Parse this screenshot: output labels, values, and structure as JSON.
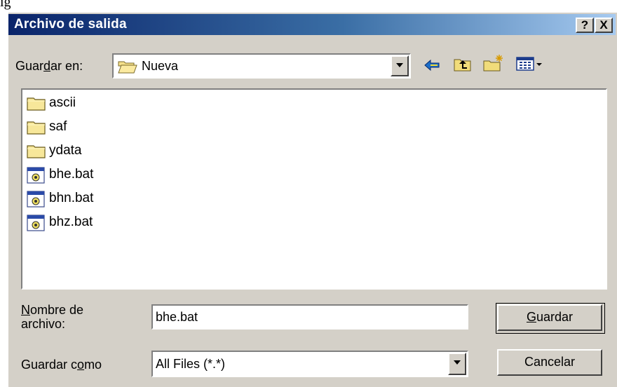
{
  "window": {
    "title": "Archivo de salida",
    "help_button": "?",
    "close_button": "X"
  },
  "save_in": {
    "label_pre": "Guar",
    "label_key": "d",
    "label_post": "ar en:",
    "location": "Nueva",
    "location_icon": "folder-open-icon"
  },
  "toolbar": {
    "back_icon": "back-arrow-icon",
    "up_icon": "up-one-level-icon",
    "new_folder_icon": "new-folder-icon",
    "view_menu_icon": "view-menu-icon"
  },
  "files": [
    {
      "name": "ascii",
      "type": "folder",
      "icon": "folder-icon"
    },
    {
      "name": "saf",
      "type": "folder",
      "icon": "folder-icon"
    },
    {
      "name": "ydata",
      "type": "folder",
      "icon": "folder-icon"
    },
    {
      "name": "bhe.bat",
      "type": "batch",
      "icon": "batch-file-icon"
    },
    {
      "name": "bhn.bat",
      "type": "batch",
      "icon": "batch-file-icon"
    },
    {
      "name": "bhz.bat",
      "type": "batch",
      "icon": "batch-file-icon"
    }
  ],
  "filename": {
    "label_line1_key": "N",
    "label_line1_rest": "ombre de",
    "label_line2": "archivo:",
    "value": "bhe.bat"
  },
  "save_as": {
    "label_pre": "Guardar c",
    "label_key": "o",
    "label_post": "mo",
    "value": "All Files (*.*)"
  },
  "buttons": {
    "save_key": "G",
    "save_rest": "uardar",
    "cancel": "Cancelar"
  },
  "caption_fragment": "ig"
}
